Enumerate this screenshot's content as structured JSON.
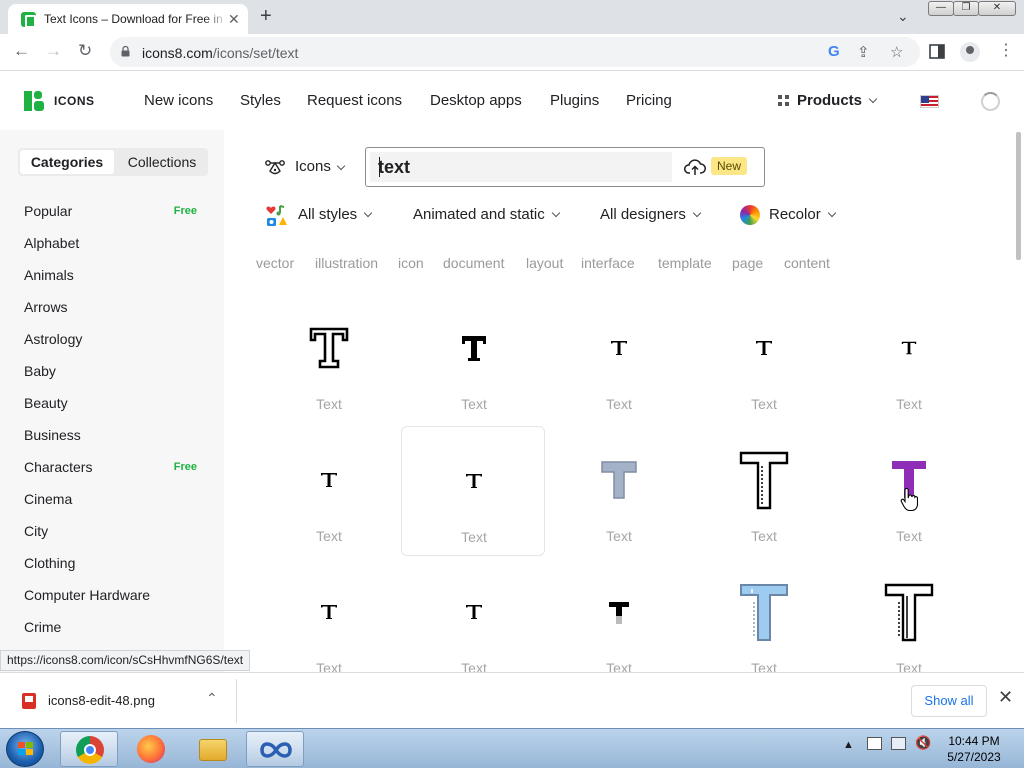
{
  "browser": {
    "tab_title": "Text Icons – Download for Free in",
    "tab_close": "✕",
    "new_tab": "+",
    "url_host": "icons8.com",
    "url_path": "/icons/set/text",
    "window_min": "—",
    "window_max": "❐",
    "window_close": "✕"
  },
  "site": {
    "logo_text": "ICONS",
    "nav": [
      "New icons",
      "Styles",
      "Request icons",
      "Desktop apps",
      "Plugins",
      "Pricing"
    ],
    "products_label": "Products"
  },
  "sidebar": {
    "tabs": [
      "Categories",
      "Collections"
    ],
    "categories": [
      {
        "label": "Popular",
        "badge": "Free"
      },
      {
        "label": "Alphabet",
        "badge": ""
      },
      {
        "label": "Animals",
        "badge": ""
      },
      {
        "label": "Arrows",
        "badge": ""
      },
      {
        "label": "Astrology",
        "badge": ""
      },
      {
        "label": "Baby",
        "badge": ""
      },
      {
        "label": "Beauty",
        "badge": ""
      },
      {
        "label": "Business",
        "badge": ""
      },
      {
        "label": "Characters",
        "badge": "Free"
      },
      {
        "label": "Cinema",
        "badge": ""
      },
      {
        "label": "City",
        "badge": ""
      },
      {
        "label": "Clothing",
        "badge": ""
      },
      {
        "label": "Computer Hardware",
        "badge": ""
      },
      {
        "label": "Crime",
        "badge": ""
      }
    ]
  },
  "search": {
    "type_label": "Icons",
    "query": "text",
    "new_badge": "New"
  },
  "filters": {
    "styles": "All styles",
    "animation": "Animated and static",
    "designers": "All designers",
    "recolor": "Recolor"
  },
  "tags": [
    "vector",
    "illustration",
    "icon",
    "document",
    "layout",
    "interface",
    "template",
    "page",
    "content"
  ],
  "grid": {
    "label": "Text",
    "rows": [
      [
        {
          "style": "outline-serif",
          "color": "#000000"
        },
        {
          "style": "bold-serif",
          "color": "#000000"
        },
        {
          "style": "serif",
          "color": "#000000"
        },
        {
          "style": "serif",
          "color": "#000000"
        },
        {
          "style": "serif-small",
          "color": "#000000"
        }
      ],
      [
        {
          "style": "serif",
          "color": "#000000"
        },
        {
          "style": "serif",
          "color": "#000000"
        },
        {
          "style": "filled-gray",
          "color": "#a3b2c7"
        },
        {
          "style": "outline-tall",
          "color": "#000000"
        },
        {
          "style": "filled-purple",
          "color": "#8e2db5"
        }
      ],
      [
        {
          "style": "serif",
          "color": "#000000"
        },
        {
          "style": "serif",
          "color": "#000000"
        },
        {
          "style": "sans-bold",
          "color": "#000000"
        },
        {
          "style": "filled-blue",
          "color": "#9ecbf0"
        },
        {
          "style": "outline-tall-dotted",
          "color": "#000000"
        }
      ]
    ]
  },
  "status_url": "https://icons8.com/icon/sCsHhvmfNG6S/text",
  "downloads": {
    "file_name": "icons8-edit-48.png",
    "show_all": "Show all"
  },
  "taskbar": {
    "time": "10:44 PM",
    "date": "5/27/2023"
  }
}
